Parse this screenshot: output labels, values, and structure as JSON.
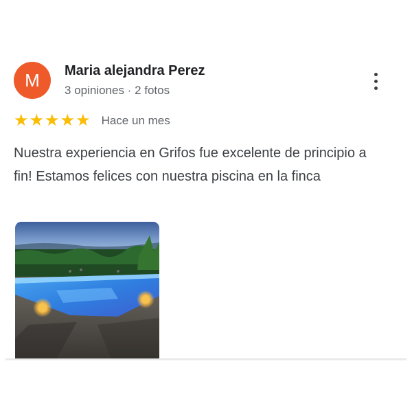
{
  "review": {
    "author": {
      "initial": "M",
      "avatar_color": "#ef5a2a",
      "name": "Maria alejandra Perez",
      "meta": "3 opiniones · 2 fotos"
    },
    "more_icon": "more-vert-icon",
    "rating": 5,
    "rating_max": 5,
    "star_color": "#fbbc04",
    "date": "Hace un mes",
    "text": "Nuestra experiencia en Grifos fue excelente de principio a fin! Estamos felices con nuestra piscina en la finca",
    "photos_visible": 1
  }
}
